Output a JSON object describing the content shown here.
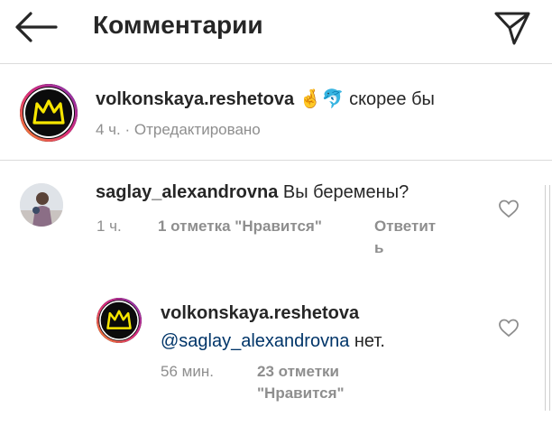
{
  "header": {
    "title": "Комментарии",
    "back_icon": "arrow-left-icon",
    "send_icon": "paper-plane-icon"
  },
  "caption": {
    "username": "volkonskaya.reshetova",
    "emoji": "🤞🐬",
    "text": "скорее бы",
    "meta": "4 ч. · Отредактировано"
  },
  "comments": [
    {
      "username": "saglay_alexandrovna",
      "text": "Вы беремены?",
      "time": "1 ч.",
      "likes": "1 отметка \"Нравится\"",
      "reply_line1": "Ответит",
      "reply_line2": "ь"
    }
  ],
  "reply": {
    "username": "volkonskaya.reshetova",
    "mention": "@saglay_alexandrovna",
    "text": " нет.",
    "time": "56 мин.",
    "likes_line1": "23 отметки",
    "likes_line2": "\"Нравится\""
  },
  "colors": {
    "text": "#262626",
    "secondary": "#8e8e8e",
    "mention": "#003569",
    "crown": "#f7e600",
    "ring_start": "#f58529",
    "ring_end": "#8134af"
  }
}
